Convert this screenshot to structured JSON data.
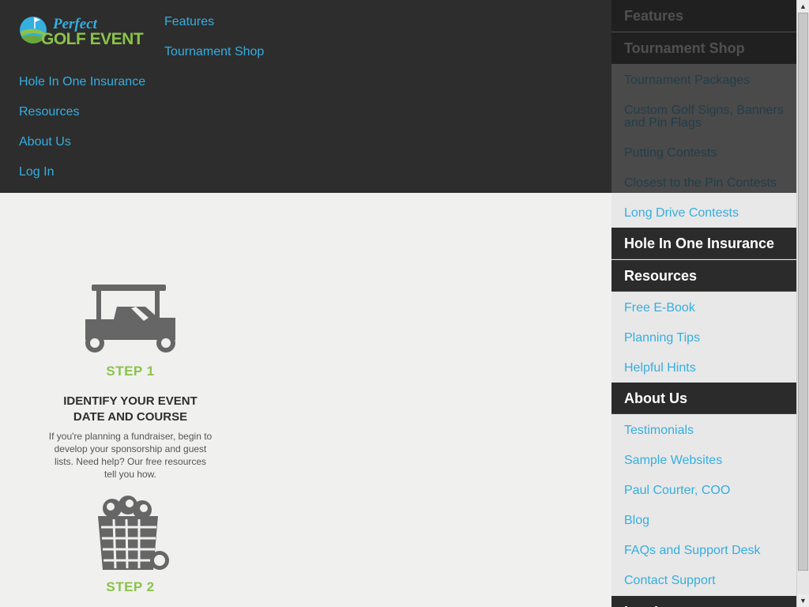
{
  "brand": {
    "logo_text_top": "Perfect",
    "logo_text_bottom": "GOLF EVENT",
    "colors": {
      "logo_blue": "#35aee0",
      "logo_green": "#8bc34a"
    }
  },
  "topnav": {
    "features": "Features",
    "tournament_shop": "Tournament Shop",
    "hole_in_one": "Hole In One Insurance",
    "resources": "Resources",
    "about_us": "About Us",
    "log_in": "Log In"
  },
  "steps": [
    {
      "icon": "golf-cart-icon",
      "label": "STEP 1",
      "title": "IDENTIFY YOUR EVENT DATE AND COURSE",
      "body": "If you're planning a fundraiser, begin to develop your sponsorship and guest lists. Need help? Our free resources tell you how."
    },
    {
      "icon": "golf-ball-basket-icon",
      "label": "STEP 2"
    }
  ],
  "side_menu": {
    "features": "Features",
    "tournament_shop": "Tournament Shop",
    "shop_items": [
      "Tournament Packages",
      "Custom Golf Signs, Banners and Pin Flags",
      "Putting Contests",
      "Closest to the Pin Contests",
      "Long Drive Contests"
    ],
    "hole_in_one": "Hole In One Insurance",
    "resources": "Resources",
    "resource_items": [
      "Free E-Book",
      "Planning Tips",
      "Helpful Hints"
    ],
    "about_us": "About Us",
    "about_items": [
      "Testimonials",
      "Sample Websites",
      "Paul Courter, COO",
      "Blog",
      "FAQs and Support Desk",
      "Contact Support"
    ],
    "log_in": "Log In"
  },
  "colors": {
    "link": "#35aee0",
    "step_green": "#8bc34a",
    "dark_bar": "#2d2d2d",
    "menu_bg": "#e8e8e8"
  }
}
